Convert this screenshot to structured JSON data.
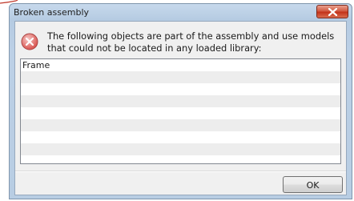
{
  "window": {
    "title": "Broken assembly"
  },
  "message": "The following objects are part of the assembly and use models that could not be located in any loaded library:",
  "objects": [
    "Frame"
  ],
  "buttons": {
    "ok_label": "OK"
  },
  "icons": {
    "close": "close-icon",
    "error": "error-icon"
  },
  "colors": {
    "close_button": "#c9442a",
    "error_icon": "#d9534f",
    "list_row_alt": "#ededed"
  }
}
